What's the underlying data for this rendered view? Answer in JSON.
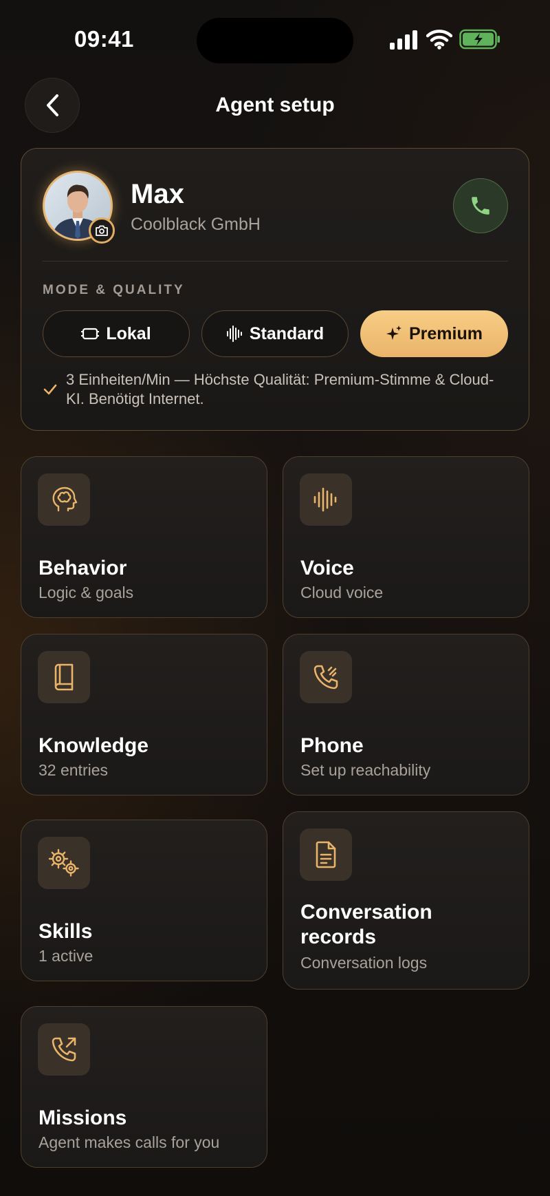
{
  "status_bar": {
    "time": "09:41"
  },
  "header": {
    "title": "Agent setup"
  },
  "agent": {
    "name": "Max",
    "company": "Coolblack GmbH",
    "mode_label": "MODE & QUALITY",
    "modes": [
      {
        "label": "Lokal",
        "icon": "chip-icon",
        "selected": false
      },
      {
        "label": "Standard",
        "icon": "waveform-icon",
        "selected": false
      },
      {
        "label": "Premium",
        "icon": "sparkle-icon",
        "selected": true
      }
    ],
    "mode_note": "3 Einheiten/Min — Höchste Qualität: Premium-Stimme & Cloud-KI. Benötigt Internet."
  },
  "tiles": [
    {
      "title": "Behavior",
      "subtitle": "Logic & goals",
      "icon": "brain-icon"
    },
    {
      "title": "Voice",
      "subtitle": "Cloud voice",
      "icon": "waveform-icon"
    },
    {
      "title": "Knowledge",
      "subtitle": "32 entries",
      "icon": "book-icon"
    },
    {
      "title": "Phone",
      "subtitle": "Set up reachability",
      "icon": "phone-signal-icon"
    },
    {
      "title": "Skills",
      "subtitle": "1 active",
      "icon": "gears-icon"
    },
    {
      "title": "Conversation records",
      "subtitle": "Conversation logs",
      "icon": "document-icon"
    },
    {
      "title": "Missions",
      "subtitle": "Agent makes calls for you",
      "icon": "outgoing-call-icon"
    }
  ],
  "colors": {
    "accent": "#eab46a",
    "call_green": "#8fd483",
    "background": "#131110"
  }
}
